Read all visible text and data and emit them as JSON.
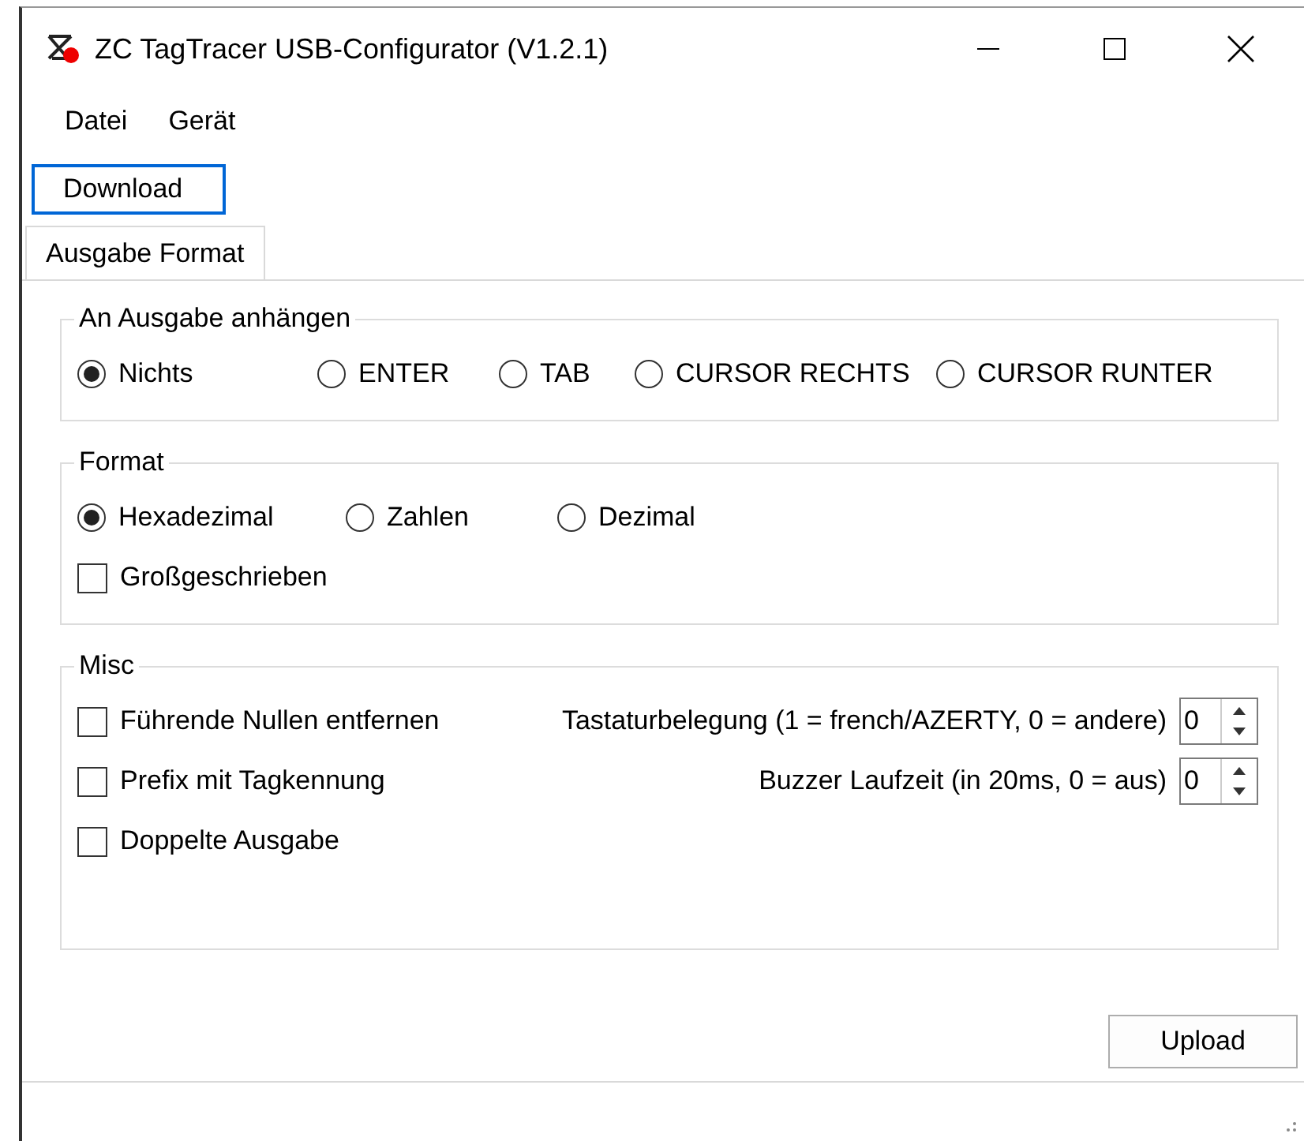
{
  "window": {
    "title": "ZC TagTracer USB-Configurator (V1.2.1)"
  },
  "menu": [
    "Datei",
    "Gerät"
  ],
  "toolbar": {
    "button": "Download",
    "focused": true
  },
  "tabs": [
    {
      "label": "Ausgabe Format",
      "selected": true
    }
  ],
  "groups": [
    {
      "title": "An Ausgabe anhängen",
      "options": [
        {
          "kind": "radio",
          "label": "Nichts",
          "selected": true
        },
        {
          "kind": "radio",
          "label": "ENTER",
          "selected": false
        },
        {
          "kind": "radio",
          "label": "TAB",
          "selected": false
        },
        {
          "kind": "radio",
          "label": "CURSOR RECHTS",
          "selected": false
        },
        {
          "kind": "radio",
          "label": "CURSOR RUNTER",
          "selected": false
        }
      ]
    },
    {
      "title": "Format",
      "options": [
        {
          "kind": "radio",
          "label": "Hexadezimal",
          "selected": true
        },
        {
          "kind": "radio",
          "label": "Zahlen",
          "selected": false
        },
        {
          "kind": "radio",
          "label": "Dezimal",
          "selected": false
        },
        {
          "kind": "checkbox",
          "label": "Großgeschrieben",
          "checked": false
        }
      ]
    },
    {
      "title": "Misc",
      "options": [
        {
          "kind": "checkbox",
          "label": "Führende Nullen entfernen",
          "checked": false
        },
        {
          "kind": "checkbox",
          "label": "Prefix mit Tagkennung",
          "checked": false
        },
        {
          "kind": "checkbox",
          "label": "Doppelte Ausgabe",
          "checked": false
        }
      ],
      "spinners": [
        {
          "label": "Tastaturbelegung (1 = french/AZERTY, 0 = andere)",
          "value": "0"
        },
        {
          "label": "Buzzer Laufzeit (in 20ms, 0 = aus)",
          "value": "0"
        }
      ]
    }
  ],
  "footer": {
    "button": "Upload"
  }
}
